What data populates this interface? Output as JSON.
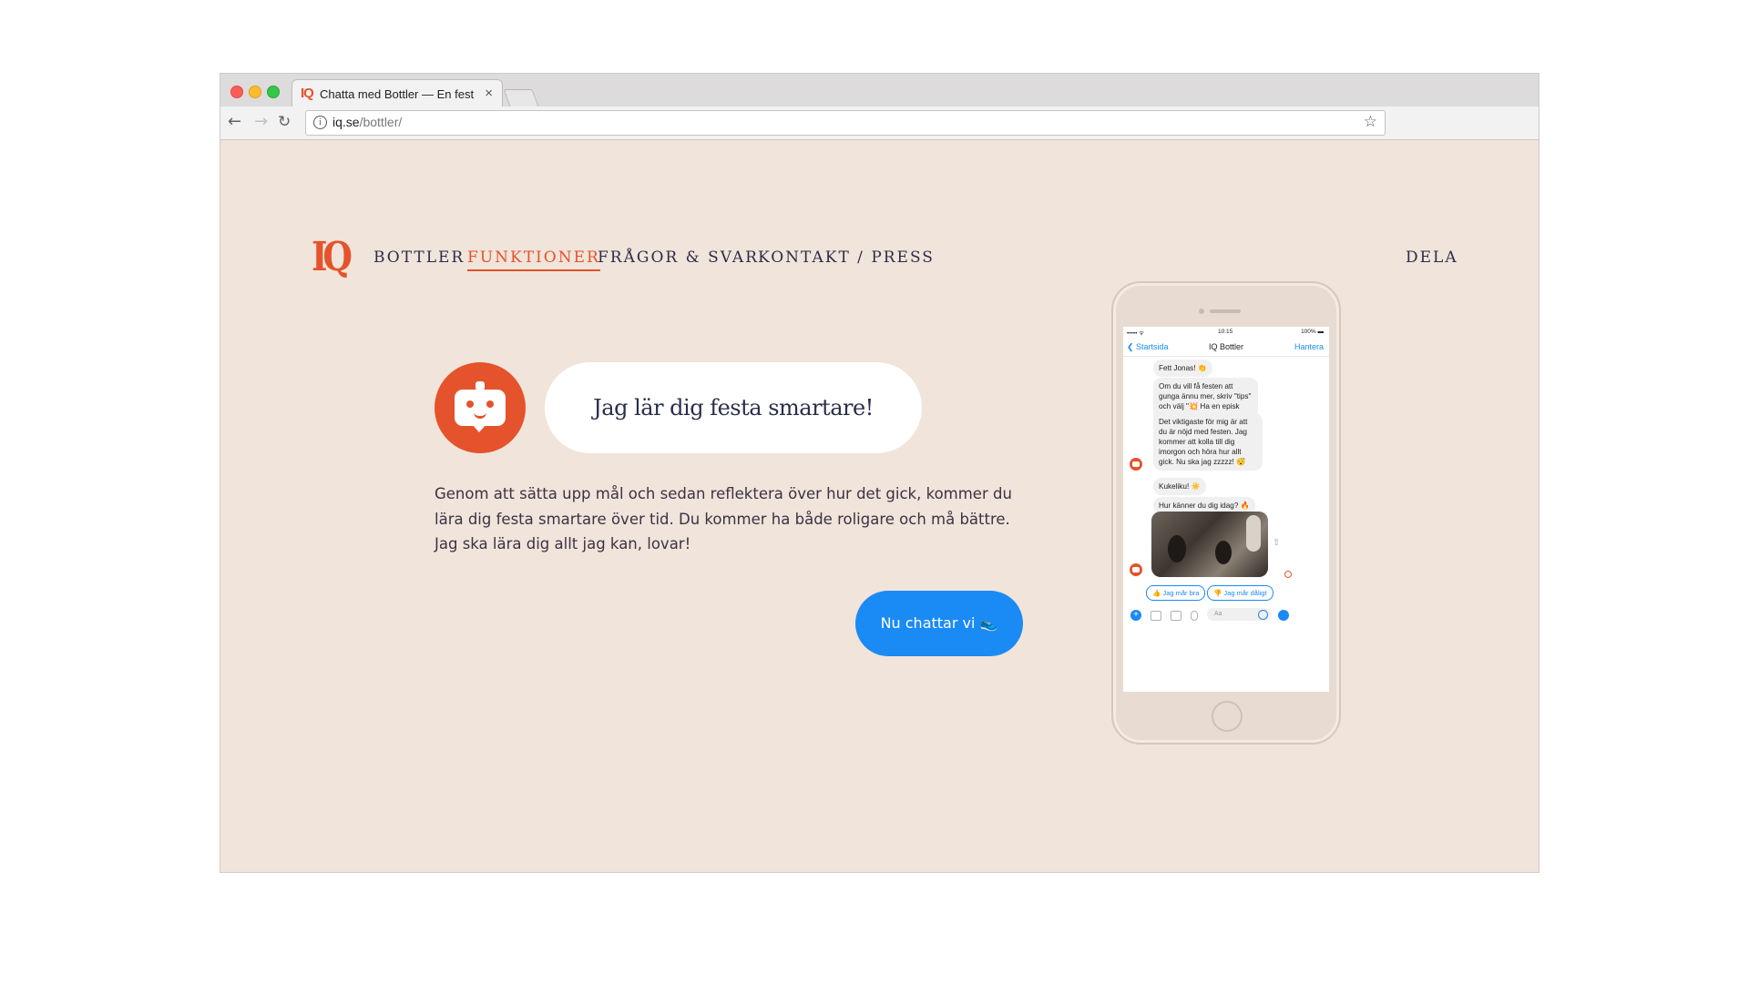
{
  "browser": {
    "tab_logo": "IQ",
    "tab_title": "Chatta med Bottler — En festbot",
    "tab_close": "×",
    "url_host": "iq.se",
    "url_path": "/bottler/",
    "info_icon": "i",
    "back_icon": "←",
    "forward_icon": "→",
    "reload_icon": "↻",
    "star_icon": "☆"
  },
  "site": {
    "logo": "IQ",
    "nav": {
      "bottler": "BOTTLER",
      "funktioner": "FUNKTIONER",
      "fragor": "FRÅGOR & SVAR",
      "kontakt": "KONTAKT / PRESS",
      "dela": "DELA"
    },
    "accent_color": "#e4532c",
    "cta_color": "#1a8af5"
  },
  "hero": {
    "bubble_text": "Jag lär dig festa smartare!",
    "body_text": "Genom att sätta upp mål och sedan reflektera över hur det gick, kommer du lära dig festa smartare över tid. Du kommer ha både roligare och må bättre. Jag ska lära dig allt jag kan, lovar!",
    "cta_label": "Nu chattar vi 👟"
  },
  "phone": {
    "status_signal": "••••• ᯤ",
    "status_time": "10:15",
    "status_battery": "100% ▬",
    "header_back": "❮ Startsida",
    "header_title": "IQ Bottler",
    "header_manage": "Hantera",
    "messages": [
      "Fett Jonas! 👏",
      "Om du vill få festen att gunga ännu mer, skriv \"tips\" och välj \"💥 Ha en episk fest\".",
      "Det viktigaste för mig är att du är nöjd med festen. Jag kommer att kolla till dig imorgon och höra hur allt gick. Nu ska jag zzzzz! 😴",
      "Kukeliku! ☀️",
      "Hur känner du dig idag? 🔥"
    ],
    "quick_replies": [
      "👍 Jag mår bra",
      "👎 Jag mår dåligt"
    ],
    "composer_placeholder": "Aa",
    "composer_plus": "+",
    "share_icon": "⇧"
  }
}
